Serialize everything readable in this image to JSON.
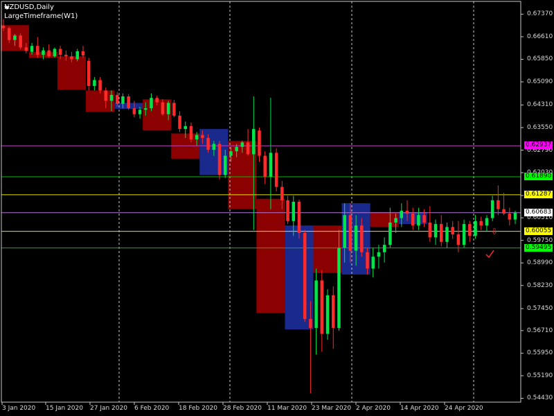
{
  "header": {
    "symbol": "NZDUSD,Daily",
    "indicator": "LargeTimeframe(W1)"
  },
  "colors": {
    "bull": "#00e64a",
    "bear": "#ff2a2a",
    "boxUp": "#1a2a8c",
    "boxDown": "#8b0000",
    "grid": "#c8c8c8",
    "axis": "#c8c8c8",
    "lineMagenta": "#c040c0",
    "lineGreen": "#00c000",
    "lineYellow": "#e6e600",
    "lineViolet": "#b078d8"
  },
  "chart_data": {
    "type": "candlestick",
    "ylim": [
      0.543,
      0.678
    ],
    "yticks": [
      "0.67370",
      "0.66610",
      "0.65850",
      "0.65090",
      "0.64310",
      "0.63550",
      "0.62790",
      "0.62030",
      "0.61260",
      "0.60510",
      "0.59750",
      "0.58990",
      "0.58230",
      "0.57450",
      "0.56710",
      "0.55950",
      "0.55190",
      "0.54430"
    ],
    "xticks": [
      "3 Jan 2020",
      "15 Jan 2020",
      "27 Jan 2020",
      "6 Feb 2020",
      "18 Feb 2020",
      "28 Feb 2020",
      "11 Mar 2020",
      "23 Mar 2020",
      "2 Apr 2020",
      "14 Apr 2020",
      "24 Apr 2020"
    ],
    "price_lines": [
      {
        "value": 0.62937,
        "label": "0.62937",
        "color": "#ff00ff",
        "line": "#c040c0"
      },
      {
        "value": 0.6189,
        "label": "0.61890",
        "color": "#00ff00",
        "line": "#00c000"
      },
      {
        "value": 0.61287,
        "label": "0.61287",
        "color": "#ffff00",
        "line": "#e6e600"
      },
      {
        "value": 0.60683,
        "label": "0.60683",
        "color": "#ffffff",
        "line": "#b078d8"
      },
      {
        "value": 0.60055,
        "label": "0.60055",
        "color": "#ffff00",
        "line": "#e6e600"
      },
      {
        "value": 0.59495,
        "label": "0.59495",
        "color": "#00ff00",
        "line": "#00c000"
      }
    ],
    "weekly_boxes": [
      {
        "start": 0,
        "end": 4,
        "open": 0.67,
        "close": 0.6613
      },
      {
        "start": 5,
        "end": 9,
        "open": 0.661,
        "close": 0.659
      },
      {
        "start": 10,
        "end": 14,
        "open": 0.6595,
        "close": 0.6482
      },
      {
        "start": 15,
        "end": 19,
        "open": 0.648,
        "close": 0.6408
      },
      {
        "start": 20,
        "end": 24,
        "open": 0.6418,
        "close": 0.6438
      },
      {
        "start": 25,
        "end": 29,
        "open": 0.645,
        "close": 0.6345
      },
      {
        "start": 30,
        "end": 34,
        "open": 0.6335,
        "close": 0.625
      },
      {
        "start": 35,
        "end": 39,
        "open": 0.6195,
        "close": 0.635
      },
      {
        "start": 40,
        "end": 44,
        "open": 0.631,
        "close": 0.608
      },
      {
        "start": 45,
        "end": 49,
        "open": 0.6115,
        "close": 0.573
      },
      {
        "start": 50,
        "end": 54,
        "open": 0.5675,
        "close": 0.6025
      },
      {
        "start": 55,
        "end": 59,
        "open": 0.6025,
        "close": 0.5865
      },
      {
        "start": 60,
        "end": 64,
        "open": 0.586,
        "close": 0.61
      },
      {
        "start": 65,
        "end": 69,
        "open": 0.607,
        "close": 0.602
      },
      {
        "start": 70,
        "end": 74,
        "open": 0.603,
        "close": 0.607
      }
    ],
    "candles": [
      [
        0.6698,
        0.672,
        0.668,
        0.669
      ],
      [
        0.669,
        0.6695,
        0.664,
        0.665
      ],
      [
        0.665,
        0.667,
        0.663,
        0.6665
      ],
      [
        0.6665,
        0.6672,
        0.6618,
        0.6625
      ],
      [
        0.6625,
        0.664,
        0.6605,
        0.6613
      ],
      [
        0.661,
        0.664,
        0.66,
        0.663
      ],
      [
        0.663,
        0.666,
        0.659,
        0.66
      ],
      [
        0.66,
        0.6625,
        0.6585,
        0.6615
      ],
      [
        0.6615,
        0.6635,
        0.659,
        0.6595
      ],
      [
        0.6595,
        0.6625,
        0.659,
        0.662
      ],
      [
        0.662,
        0.663,
        0.6585,
        0.66
      ],
      [
        0.66,
        0.6615,
        0.658,
        0.6595
      ],
      [
        0.6595,
        0.661,
        0.6575,
        0.6585
      ],
      [
        0.6585,
        0.662,
        0.6578,
        0.6612
      ],
      [
        0.6612,
        0.663,
        0.659,
        0.6598
      ],
      [
        0.658,
        0.659,
        0.648,
        0.6495
      ],
      [
        0.6495,
        0.6525,
        0.648,
        0.6515
      ],
      [
        0.6515,
        0.6525,
        0.647,
        0.648
      ],
      [
        0.648,
        0.649,
        0.642,
        0.6445
      ],
      [
        0.6445,
        0.648,
        0.641,
        0.6465
      ],
      [
        0.6465,
        0.6475,
        0.6425,
        0.6435
      ],
      [
        0.6435,
        0.647,
        0.642,
        0.646
      ],
      [
        0.646,
        0.6468,
        0.6415,
        0.642
      ],
      [
        0.642,
        0.6445,
        0.639,
        0.64
      ],
      [
        0.64,
        0.6425,
        0.6385,
        0.6415
      ],
      [
        0.6415,
        0.644,
        0.6395,
        0.642
      ],
      [
        0.642,
        0.647,
        0.641,
        0.6455
      ],
      [
        0.6455,
        0.6462,
        0.643,
        0.644
      ],
      [
        0.644,
        0.645,
        0.6395,
        0.64
      ],
      [
        0.64,
        0.6445,
        0.638,
        0.6438
      ],
      [
        0.6438,
        0.6448,
        0.639,
        0.6395
      ],
      [
        0.6395,
        0.641,
        0.634,
        0.635
      ],
      [
        0.635,
        0.6375,
        0.632,
        0.636
      ],
      [
        0.636,
        0.6372,
        0.6305,
        0.6315
      ],
      [
        0.6315,
        0.634,
        0.6295,
        0.633
      ],
      [
        0.633,
        0.6345,
        0.63,
        0.632
      ],
      [
        0.632,
        0.6332,
        0.627,
        0.628
      ],
      [
        0.628,
        0.631,
        0.626,
        0.63
      ],
      [
        0.63,
        0.631,
        0.618,
        0.6195
      ],
      [
        0.6195,
        0.628,
        0.6185,
        0.626
      ],
      [
        0.626,
        0.629,
        0.624,
        0.6275
      ],
      [
        0.6275,
        0.63,
        0.6255,
        0.629
      ],
      [
        0.629,
        0.631,
        0.627,
        0.6305
      ],
      [
        0.6305,
        0.635,
        0.626,
        0.6265
      ],
      [
        0.6265,
        0.646,
        0.601,
        0.635
      ],
      [
        0.6345,
        0.6355,
        0.624,
        0.626
      ],
      [
        0.626,
        0.6275,
        0.6165,
        0.619
      ],
      [
        0.619,
        0.6455,
        0.608,
        0.627
      ],
      [
        0.627,
        0.6285,
        0.614,
        0.6155
      ],
      [
        0.6155,
        0.6175,
        0.608,
        0.611
      ],
      [
        0.611,
        0.6125,
        0.603,
        0.604
      ],
      [
        0.604,
        0.6125,
        0.599,
        0.6105
      ],
      [
        0.6105,
        0.6112,
        0.598,
        0.6
      ],
      [
        0.6,
        0.601,
        0.57,
        0.571
      ],
      [
        0.571,
        0.577,
        0.546,
        0.568
      ],
      [
        0.568,
        0.588,
        0.559,
        0.584
      ],
      [
        0.584,
        0.5875,
        0.56,
        0.566
      ],
      [
        0.566,
        0.581,
        0.564,
        0.579
      ],
      [
        0.579,
        0.582,
        0.561,
        0.568
      ],
      [
        0.568,
        0.601,
        0.567,
        0.595
      ],
      [
        0.595,
        0.61,
        0.59,
        0.606
      ],
      [
        0.606,
        0.61,
        0.59,
        0.594
      ],
      [
        0.594,
        0.606,
        0.589,
        0.6025
      ],
      [
        0.6025,
        0.605,
        0.592,
        0.5935
      ],
      [
        0.5935,
        0.595,
        0.586,
        0.588
      ],
      [
        0.588,
        0.595,
        0.585,
        0.592
      ],
      [
        0.592,
        0.596,
        0.588,
        0.5935
      ],
      [
        0.5935,
        0.5985,
        0.59,
        0.596
      ],
      [
        0.596,
        0.6085,
        0.595,
        0.6035
      ],
      [
        0.6035,
        0.6065,
        0.6,
        0.605
      ],
      [
        0.605,
        0.61,
        0.602,
        0.6075
      ],
      [
        0.6075,
        0.611,
        0.604,
        0.6065
      ],
      [
        0.6065,
        0.6085,
        0.601,
        0.6025
      ],
      [
        0.6025,
        0.6085,
        0.601,
        0.606
      ],
      [
        0.606,
        0.608,
        0.602,
        0.6035
      ],
      [
        0.6035,
        0.609,
        0.597,
        0.5985
      ],
      [
        0.5985,
        0.6045,
        0.596,
        0.603
      ],
      [
        0.603,
        0.606,
        0.5955,
        0.597
      ],
      [
        0.597,
        0.6035,
        0.595,
        0.602
      ],
      [
        0.602,
        0.604,
        0.598,
        0.5995
      ],
      [
        0.5995,
        0.604,
        0.5935,
        0.596
      ],
      [
        0.596,
        0.6045,
        0.595,
        0.603
      ],
      [
        0.603,
        0.604,
        0.597,
        0.599
      ],
      [
        0.599,
        0.606,
        0.598,
        0.604
      ],
      [
        0.604,
        0.6055,
        0.601,
        0.6025
      ],
      [
        0.6025,
        0.606,
        0.6005,
        0.605
      ],
      [
        0.605,
        0.6125,
        0.604,
        0.611
      ],
      [
        0.611,
        0.616,
        0.606,
        0.608
      ],
      [
        0.608,
        0.6135,
        0.606,
        0.6065
      ],
      [
        0.6065,
        0.6085,
        0.6025,
        0.6045
      ],
      [
        0.6045,
        0.6075,
        0.603,
        0.6068
      ]
    ]
  }
}
